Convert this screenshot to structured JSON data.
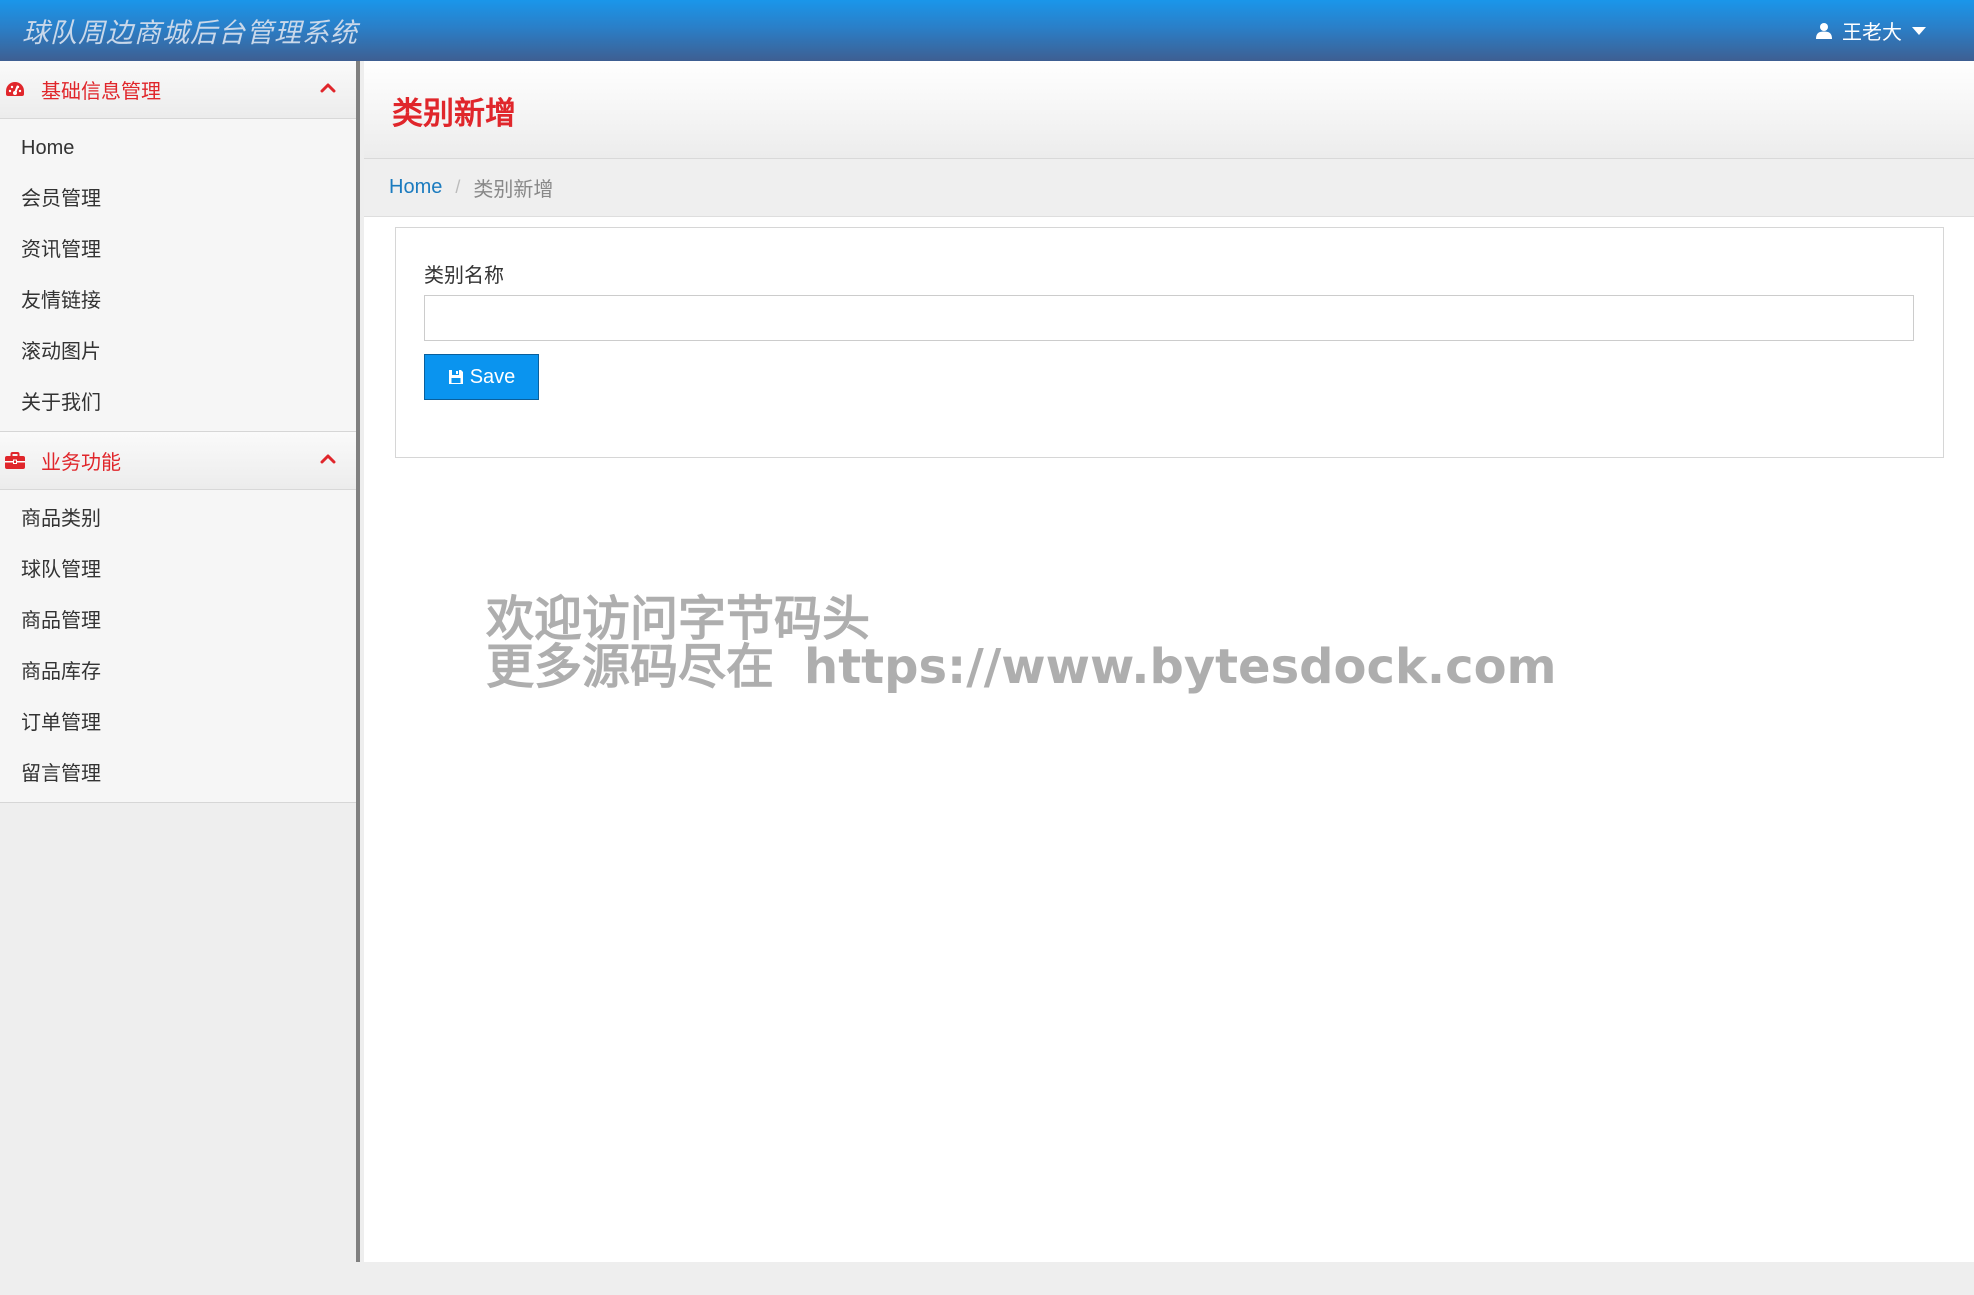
{
  "app": {
    "title": "球队周边商城后台管理系统",
    "user_name": "王老大"
  },
  "colors": {
    "accent_red": "#e0262b",
    "primary_blue": "#0a94ef",
    "link_blue": "#1a7bbf"
  },
  "icons": {
    "group1": "dashboard-icon",
    "group2": "briefcase-icon",
    "user": "user-icon",
    "save": "floppy-disk-icon"
  },
  "sidebar": {
    "groups": [
      {
        "label": "基础信息管理",
        "expanded": true,
        "items": [
          "Home",
          "会员管理",
          "资讯管理",
          "友情链接",
          "滚动图片",
          "关于我们"
        ]
      },
      {
        "label": "业务功能",
        "expanded": true,
        "items": [
          "商品类别",
          "球队管理",
          "商品管理",
          "商品库存",
          "订单管理",
          "留言管理"
        ]
      }
    ]
  },
  "page": {
    "title": "类别新增",
    "breadcrumb": {
      "home": "Home",
      "current": "类别新增"
    }
  },
  "form": {
    "field_label": "类别名称",
    "field_value": "",
    "save_label": "Save"
  },
  "watermark": {
    "line1": "欢迎访问字节码头",
    "line2_prefix": "更多源码尽在",
    "line2_url": "https://www.bytesdock.com"
  }
}
